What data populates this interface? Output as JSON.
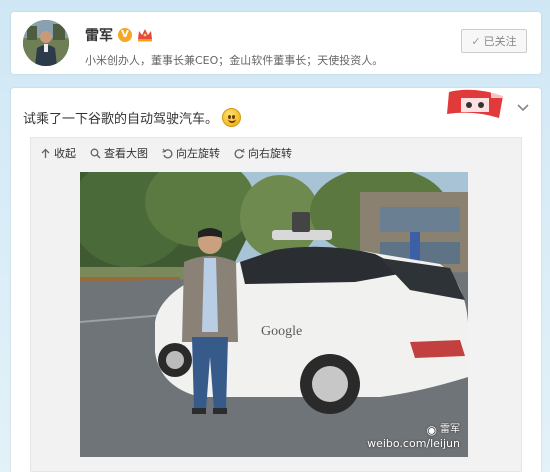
{
  "profile": {
    "name": "雷军",
    "verified_badge": "V",
    "bio": "小米创办人，董事长兼CEO；金山软件董事长；天使投资人。",
    "follow_label": "已关注",
    "follow_icon": "check-icon"
  },
  "post": {
    "text": "试乘了一下谷歌的自动驾驶汽车。",
    "emoji_icon": "smile-icon",
    "toolbar": {
      "collapse": "收起",
      "view_large": "查看大图",
      "rotate_left": "向左旋转",
      "rotate_right": "向右旋转"
    },
    "photo": {
      "car_logo_text": "Google",
      "watermark_name": "雷军",
      "watermark_url": "weibo.com/leijun"
    }
  },
  "colors": {
    "background": "#d8ecf7",
    "verified": "#f5a623",
    "deco_red": "#e03a3a"
  }
}
